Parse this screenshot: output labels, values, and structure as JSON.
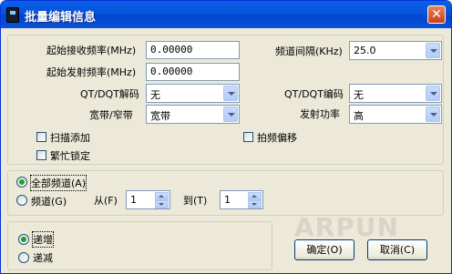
{
  "window": {
    "title": "批量编辑信息",
    "close_glyph": "✕"
  },
  "fields": {
    "rx_freq_label": "起始接收频率(MHz)",
    "rx_freq_value": "0.00000",
    "tx_freq_label": "起始发射频率(MHz)",
    "tx_freq_value": "0.00000",
    "step_label": "频道间隔(KHz)",
    "step_value": "25.0",
    "qt_decode_label": "QT/DQT解码",
    "qt_decode_value": "无",
    "qt_encode_label": "QT/DQT编码",
    "qt_encode_value": "无",
    "bandwidth_label": "宽带/窄带",
    "bandwidth_value": "宽带",
    "power_label": "发射功率",
    "power_value": "高",
    "scan_add_label": "扫描添加",
    "beat_shift_label": "拍频偏移",
    "busy_lock_label": "繁忙锁定"
  },
  "range": {
    "all_channels_label": "全部频道(A)",
    "channel_label": "频道(G)",
    "from_label": "从(F)",
    "from_value": "1",
    "to_label": "到(T)",
    "to_value": "1"
  },
  "direction": {
    "increment_label": "递增",
    "decrement_label": "递减"
  },
  "buttons": {
    "ok": "确定(O)",
    "cancel": "取消(C)"
  },
  "watermark": "ARPUN",
  "colors": {
    "title_bar": "#0054e3",
    "face": "#ece9d8",
    "radio_dot": "#21a121"
  }
}
